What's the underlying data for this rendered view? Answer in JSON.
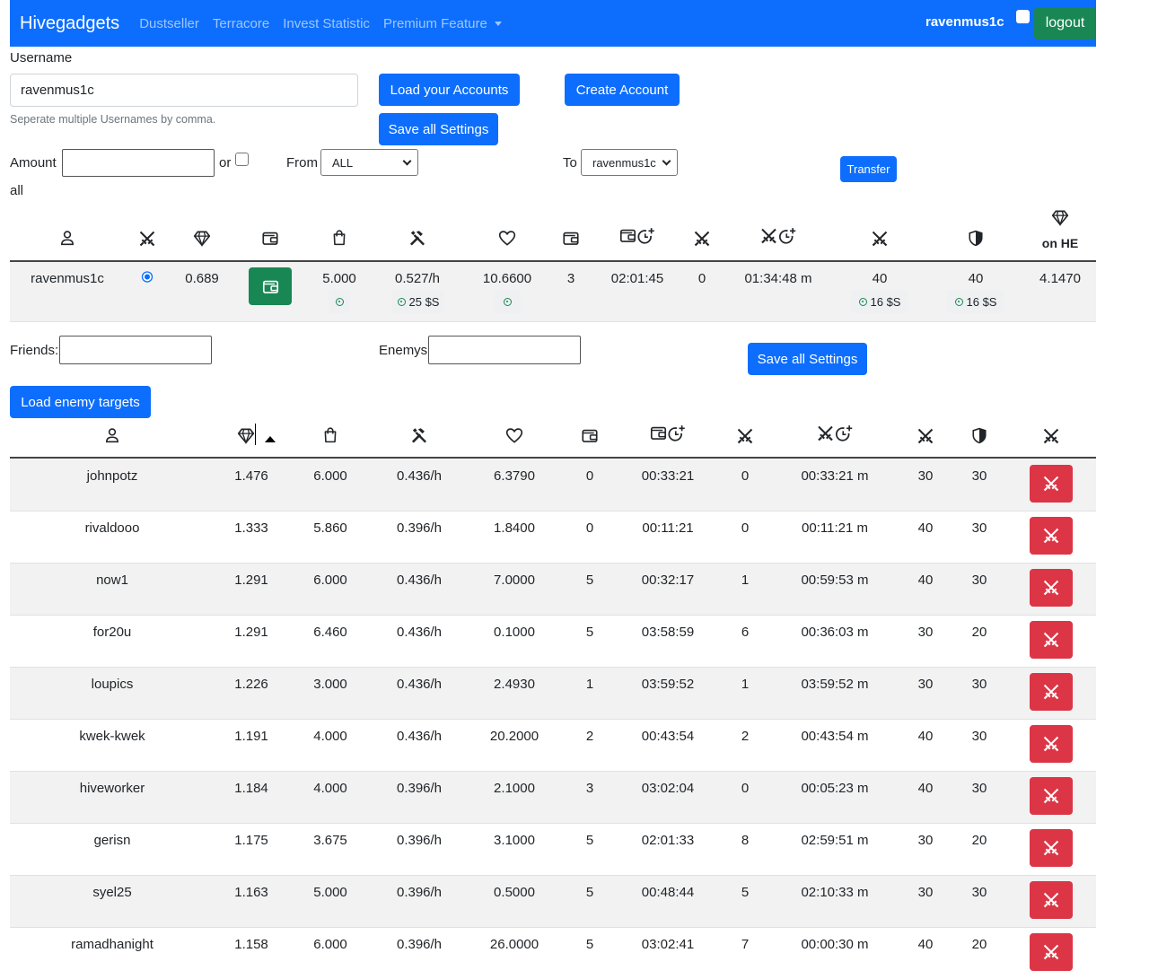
{
  "nav": {
    "brand": "Hivegadgets",
    "links": [
      "Dustseller",
      "Terracore",
      "Invest Statistic",
      "Premium Feature"
    ],
    "user": "ravenmus1c",
    "logout": "logout"
  },
  "form": {
    "username_label": "Username",
    "username_value": "ravenmus1c",
    "username_help": "Seperate multiple Usernames by comma.",
    "load_accounts": "Load your Accounts",
    "create_account": "Create Account",
    "save_settings": "Save all Settings",
    "amount_label": "Amount",
    "or_label": "or",
    "all_label": "all",
    "from_label": "From",
    "from_value": "ALL",
    "to_label": "To",
    "to_value": "ravenmus1c",
    "transfer": "Transfer"
  },
  "account_table": {
    "last_header_text": "on HE",
    "row": {
      "name": "ravenmus1c",
      "c2": "0.689",
      "c4": "5.000",
      "c5": "0.527/h",
      "c5_badge": "25 $S",
      "c6": "10.6600",
      "c7": "3",
      "c8": "02:01:45",
      "c9": "0",
      "c10": "01:34:48 m",
      "c11": "40",
      "c11_badge": "16 $S",
      "c12": "40",
      "c12_badge": "16 $S",
      "c13": "4.1470"
    }
  },
  "settings": {
    "friends_label": "Friends:",
    "enemys_label": "Enemys:",
    "save_settings": "Save all Settings",
    "load_enemy": "Load enemy targets"
  },
  "enemies": [
    [
      "johnpotz",
      "1.476",
      "6.000",
      "0.436/h",
      "6.3790",
      "0",
      "00:33:21",
      "0",
      "00:33:21 m",
      "30",
      "30"
    ],
    [
      "rivaldooo",
      "1.333",
      "5.860",
      "0.396/h",
      "1.8400",
      "0",
      "00:11:21",
      "0",
      "00:11:21 m",
      "40",
      "30"
    ],
    [
      "now1",
      "1.291",
      "6.000",
      "0.436/h",
      "7.0000",
      "5",
      "00:32:17",
      "1",
      "00:59:53 m",
      "40",
      "30"
    ],
    [
      "for20u",
      "1.291",
      "6.460",
      "0.436/h",
      "0.1000",
      "5",
      "03:58:59",
      "6",
      "00:36:03 m",
      "30",
      "20"
    ],
    [
      "loupics",
      "1.226",
      "3.000",
      "0.436/h",
      "2.4930",
      "1",
      "03:59:52",
      "1",
      "03:59:52 m",
      "30",
      "30"
    ],
    [
      "kwek-kwek",
      "1.191",
      "4.000",
      "0.436/h",
      "20.2000",
      "2",
      "00:43:54",
      "2",
      "00:43:54 m",
      "40",
      "30"
    ],
    [
      "hiveworker",
      "1.184",
      "4.000",
      "0.396/h",
      "2.1000",
      "3",
      "03:02:04",
      "0",
      "00:05:23 m",
      "40",
      "30"
    ],
    [
      "gerisn",
      "1.175",
      "3.675",
      "0.396/h",
      "3.1000",
      "5",
      "02:01:33",
      "8",
      "02:59:51 m",
      "30",
      "20"
    ],
    [
      "syel25",
      "1.163",
      "5.000",
      "0.396/h",
      "0.5000",
      "5",
      "00:48:44",
      "5",
      "02:10:33 m",
      "30",
      "30"
    ],
    [
      "ramadhanight",
      "1.158",
      "6.000",
      "0.396/h",
      "26.0000",
      "5",
      "03:02:41",
      "7",
      "00:00:30 m",
      "40",
      "20"
    ]
  ],
  "colors": {
    "primary": "#0d6efd",
    "success": "#198754",
    "danger": "#dc3545",
    "stripe": "#f2f2f2"
  }
}
